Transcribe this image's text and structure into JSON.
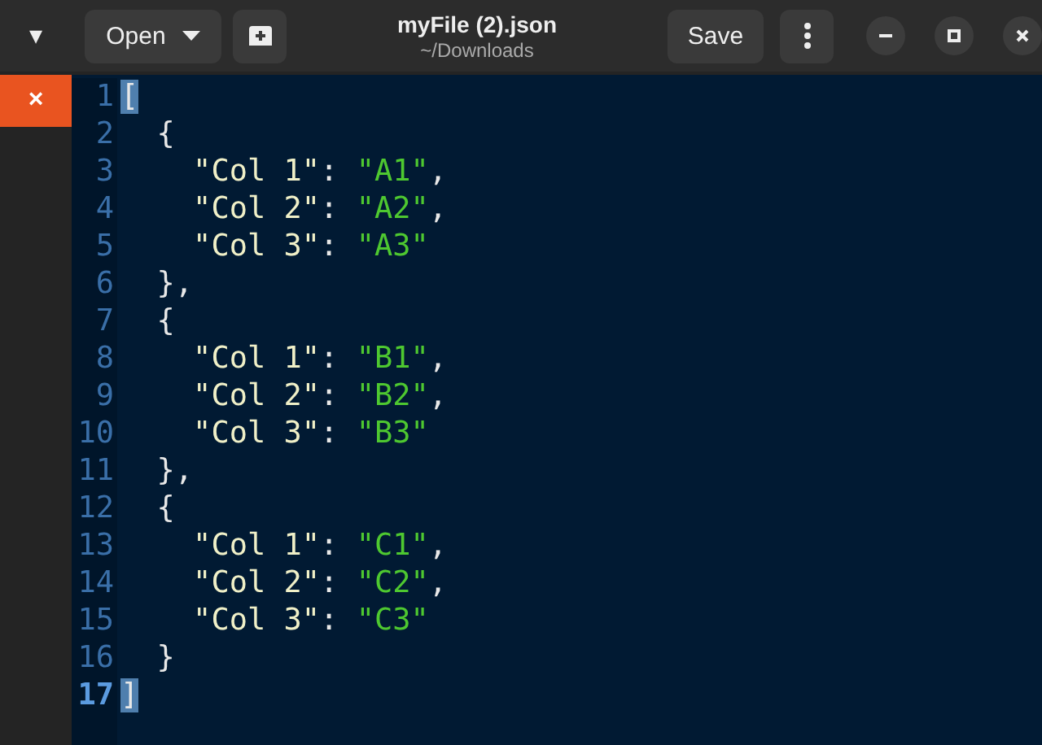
{
  "header": {
    "sidebar_toggle": "▾",
    "open_button": "Open",
    "title": "myFile (2).json",
    "subtitle": "~/Downloads",
    "save_button": "Save"
  },
  "tabs": [
    {
      "close": "×",
      "selected": true
    }
  ],
  "editor": {
    "lines": [
      {
        "number": "1",
        "current": false,
        "bracket_highlighted": true,
        "tokens": [
          {
            "kind": "punct",
            "text": "["
          }
        ]
      },
      {
        "number": "2",
        "current": false,
        "bracket_highlighted": false,
        "tokens": [
          {
            "kind": "punct",
            "text": "  {"
          }
        ]
      },
      {
        "number": "3",
        "current": false,
        "bracket_highlighted": false,
        "tokens": [
          {
            "kind": "key",
            "text": "    \"Col 1\""
          },
          {
            "kind": "punct",
            "text": ": "
          },
          {
            "kind": "string",
            "text": "\"A1\""
          },
          {
            "kind": "punct",
            "text": ","
          }
        ]
      },
      {
        "number": "4",
        "current": false,
        "bracket_highlighted": false,
        "tokens": [
          {
            "kind": "key",
            "text": "    \"Col 2\""
          },
          {
            "kind": "punct",
            "text": ": "
          },
          {
            "kind": "string",
            "text": "\"A2\""
          },
          {
            "kind": "punct",
            "text": ","
          }
        ]
      },
      {
        "number": "5",
        "current": false,
        "bracket_highlighted": false,
        "tokens": [
          {
            "kind": "key",
            "text": "    \"Col 3\""
          },
          {
            "kind": "punct",
            "text": ": "
          },
          {
            "kind": "string",
            "text": "\"A3\""
          }
        ]
      },
      {
        "number": "6",
        "current": false,
        "bracket_highlighted": false,
        "tokens": [
          {
            "kind": "punct",
            "text": "  },"
          }
        ]
      },
      {
        "number": "7",
        "current": false,
        "bracket_highlighted": false,
        "tokens": [
          {
            "kind": "punct",
            "text": "  {"
          }
        ]
      },
      {
        "number": "8",
        "current": false,
        "bracket_highlighted": false,
        "tokens": [
          {
            "kind": "key",
            "text": "    \"Col 1\""
          },
          {
            "kind": "punct",
            "text": ": "
          },
          {
            "kind": "string",
            "text": "\"B1\""
          },
          {
            "kind": "punct",
            "text": ","
          }
        ]
      },
      {
        "number": "9",
        "current": false,
        "bracket_highlighted": false,
        "tokens": [
          {
            "kind": "key",
            "text": "    \"Col 2\""
          },
          {
            "kind": "punct",
            "text": ": "
          },
          {
            "kind": "string",
            "text": "\"B2\""
          },
          {
            "kind": "punct",
            "text": ","
          }
        ]
      },
      {
        "number": "10",
        "current": false,
        "bracket_highlighted": false,
        "tokens": [
          {
            "kind": "key",
            "text": "    \"Col 3\""
          },
          {
            "kind": "punct",
            "text": ": "
          },
          {
            "kind": "string",
            "text": "\"B3\""
          }
        ]
      },
      {
        "number": "11",
        "current": false,
        "bracket_highlighted": false,
        "tokens": [
          {
            "kind": "punct",
            "text": "  },"
          }
        ]
      },
      {
        "number": "12",
        "current": false,
        "bracket_highlighted": false,
        "tokens": [
          {
            "kind": "punct",
            "text": "  {"
          }
        ]
      },
      {
        "number": "13",
        "current": false,
        "bracket_highlighted": false,
        "tokens": [
          {
            "kind": "key",
            "text": "    \"Col 1\""
          },
          {
            "kind": "punct",
            "text": ": "
          },
          {
            "kind": "string",
            "text": "\"C1\""
          },
          {
            "kind": "punct",
            "text": ","
          }
        ]
      },
      {
        "number": "14",
        "current": false,
        "bracket_highlighted": false,
        "tokens": [
          {
            "kind": "key",
            "text": "    \"Col 2\""
          },
          {
            "kind": "punct",
            "text": ": "
          },
          {
            "kind": "string",
            "text": "\"C2\""
          },
          {
            "kind": "punct",
            "text": ","
          }
        ]
      },
      {
        "number": "15",
        "current": false,
        "bracket_highlighted": false,
        "tokens": [
          {
            "kind": "key",
            "text": "    \"Col 3\""
          },
          {
            "kind": "punct",
            "text": ": "
          },
          {
            "kind": "string",
            "text": "\"C3\""
          }
        ]
      },
      {
        "number": "16",
        "current": false,
        "bracket_highlighted": false,
        "tokens": [
          {
            "kind": "punct",
            "text": "  }"
          }
        ]
      },
      {
        "number": "17",
        "current": true,
        "bracket_highlighted": true,
        "tokens": [
          {
            "kind": "punct",
            "text": "]"
          }
        ]
      }
    ]
  }
}
